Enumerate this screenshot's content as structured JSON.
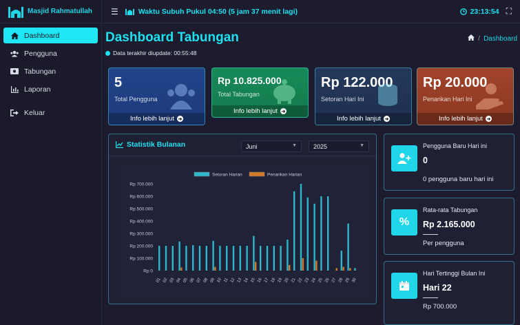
{
  "brand": {
    "name": "Masjid Rahmatullah"
  },
  "sidebar": {
    "items": [
      {
        "label": "Dashboard",
        "icon": "home-icon"
      },
      {
        "label": "Pengguna",
        "icon": "users-icon"
      },
      {
        "label": "Tabungan",
        "icon": "money-icon"
      },
      {
        "label": "Laporan",
        "icon": "chart-icon"
      },
      {
        "label": "Keluar",
        "icon": "logout-icon"
      }
    ]
  },
  "topbar": {
    "prayer": "Waktu Subuh Pukul 04:50 (5 jam 37 menit lagi)",
    "clock": "23:13:54"
  },
  "page": {
    "title": "Dashboard Tabungan",
    "updated": "Data terakhir diupdate: 00:55:48",
    "breadcrumb": "Dashboard"
  },
  "cards": [
    {
      "value": "5",
      "label": "Total Pengguna",
      "link": "Info lebih lanjut",
      "color": "#1d3a7a"
    },
    {
      "value": "Rp 10.825.000",
      "label": "Total Tabungan",
      "link": "Info lebih lanjut",
      "color": "#137a4c"
    },
    {
      "value": "Rp 122.000",
      "label": "Setoran Hari Ini",
      "link": "Info lebih lanjut",
      "color": "#1f3050"
    },
    {
      "value": "Rp 20.000",
      "label": "Penarikan Hari Ini",
      "link": "Info lebih lanjut",
      "color": "#8a3822"
    }
  ],
  "chart_panel": {
    "title": "Statistik Bulanan",
    "month": "Juni",
    "year": "2025"
  },
  "chart_data": {
    "type": "bar",
    "categories": [
      "01",
      "02",
      "03",
      "04",
      "05",
      "06",
      "07",
      "08",
      "09",
      "10",
      "11",
      "12",
      "13",
      "14",
      "15",
      "16",
      "17",
      "18",
      "19",
      "20",
      "21",
      "22",
      "23",
      "24",
      "25",
      "26",
      "27",
      "28",
      "29",
      "30"
    ],
    "series": [
      {
        "name": "Setoran Harian",
        "color": "#2fb6c8",
        "values": [
          200000,
          200000,
          200000,
          235000,
          200000,
          205000,
          200000,
          200000,
          240000,
          200000,
          200000,
          200000,
          200000,
          200000,
          280000,
          200000,
          200000,
          200000,
          200000,
          250000,
          640000,
          700000,
          590000,
          540000,
          600000,
          600000,
          0,
          160000,
          380000,
          20000
        ]
      },
      {
        "name": "Penarikan Harian",
        "color": "#d07a2a",
        "values": [
          0,
          0,
          0,
          25000,
          0,
          0,
          0,
          0,
          30000,
          0,
          0,
          0,
          0,
          0,
          70000,
          0,
          0,
          0,
          0,
          45000,
          0,
          100000,
          0,
          80000,
          0,
          0,
          20000,
          30000,
          20000,
          0
        ]
      }
    ],
    "ylim": [
      0,
      700000
    ],
    "yticks": [
      "Rp 0",
      "Rp 100.000",
      "Rp 200.000",
      "Rp 300.000",
      "Rp 400.000",
      "Rp 500.000",
      "Rp 600.000",
      "Rp 700.000"
    ],
    "legend": "top-center",
    "grid": false
  },
  "right_cards": [
    {
      "title": "Pengguna Baru Hari ini",
      "value": "0",
      "sub": "0 pengguna baru hari ini",
      "icon": "user-plus-icon"
    },
    {
      "title": "Rata-rata Tabungan",
      "value": "Rp 2.165.000",
      "sub": "Per pengguna",
      "icon": "percent-icon"
    },
    {
      "title": "Hari Tertinggi Bulan Ini",
      "value": "Hari 22",
      "sub": "Rp 700.000",
      "icon": "calendar-icon"
    }
  ]
}
